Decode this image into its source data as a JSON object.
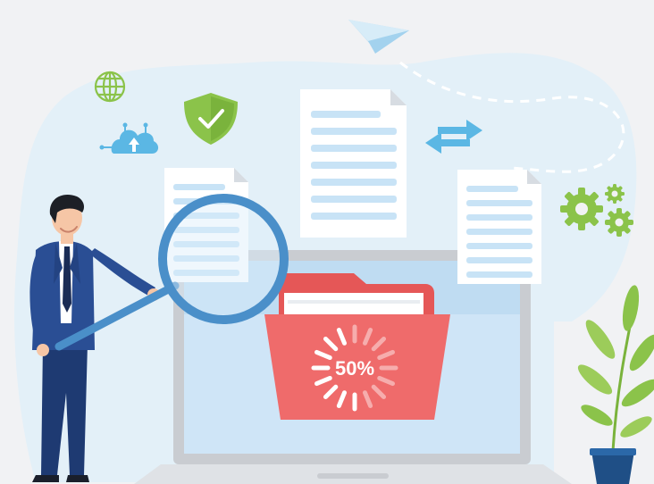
{
  "progress": {
    "label": "50%",
    "value": 0.5
  },
  "colors": {
    "background": "#f1f2f4",
    "blob": "#e3f0f8",
    "folder": "#ef6b6b",
    "folder_tab": "#e55757",
    "suit": "#2a4e94",
    "magnifier": "#4a8fc9",
    "green": "#8bc34a",
    "doc_lines": "#c8e3f6",
    "arrow": "#5bb7e4",
    "screen": "#cfe5f7"
  },
  "icons": [
    "globe-icon",
    "shield-check-icon",
    "cloud-network-icon",
    "paper-plane-icon",
    "transfer-arrows-icon",
    "gears-icon",
    "magnifying-glass-icon",
    "folder-icon",
    "loading-spinner-icon",
    "document-icon",
    "plant-icon"
  ]
}
